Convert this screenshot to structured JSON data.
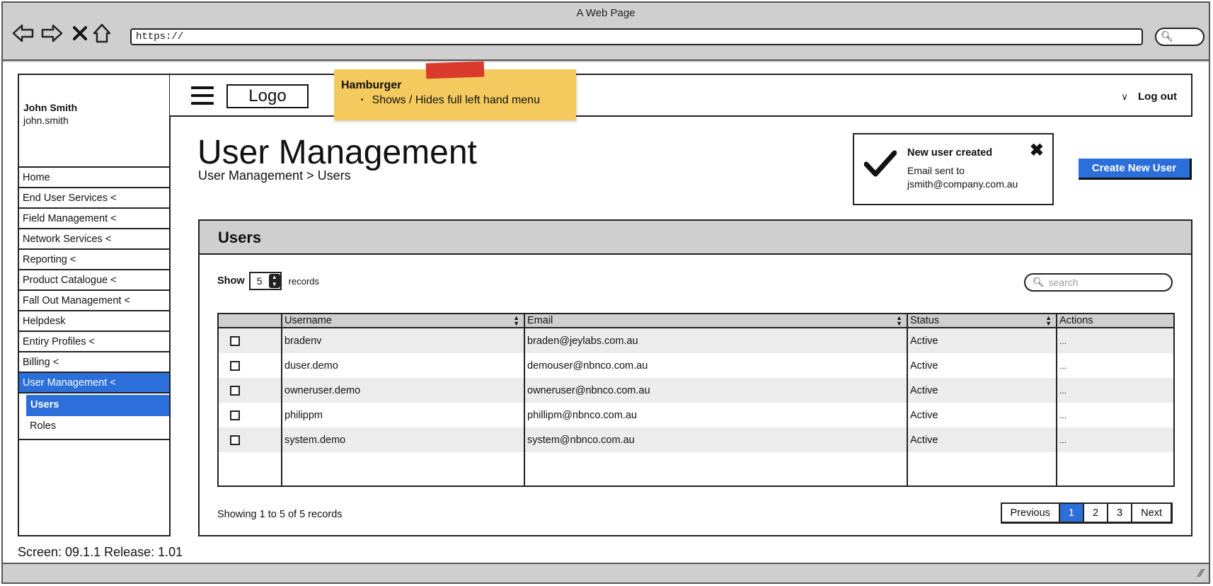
{
  "browser": {
    "title": "A Web Page",
    "url": "https://",
    "back_icon": "arrow-left-icon",
    "forward_icon": "arrow-right-icon",
    "stop_icon": "close-icon",
    "home_icon": "home-icon"
  },
  "user": {
    "name": "John Smith",
    "login": "john.smith"
  },
  "sidebar": {
    "items": [
      {
        "label": "Home"
      },
      {
        "label": "End User Services <"
      },
      {
        "label": "Field Management <"
      },
      {
        "label": "Network Services <"
      },
      {
        "label": "Reporting <"
      },
      {
        "label": "Product Catalogue <"
      },
      {
        "label": "Fall Out Management <"
      },
      {
        "label": "Helpdesk"
      },
      {
        "label": "Entiry Profiles <"
      },
      {
        "label": "Billing <"
      },
      {
        "label": "User Management <"
      }
    ],
    "sub_items": [
      {
        "label": "Users"
      },
      {
        "label": "Roles"
      }
    ]
  },
  "header": {
    "logo": "Logo",
    "logout": "Log out"
  },
  "note": {
    "title": "Hamburger",
    "body": "Shows / Hides full left hand menu"
  },
  "page": {
    "title": "User Management",
    "breadcrumb": "User Management > Users",
    "create_button": "Create New User"
  },
  "toast": {
    "title": "New user created",
    "body": "Email sent to jsmith@company.com.au"
  },
  "panel": {
    "title": "Users",
    "show_label": "Show",
    "page_size": "5",
    "records_label": "records",
    "search_placeholder": "search",
    "columns": [
      "",
      "Username",
      "Email",
      "Status",
      "Actions"
    ],
    "rows": [
      {
        "username": "bradenv",
        "email": "braden@jeylabs.com.au",
        "status": "Active",
        "actions": "..."
      },
      {
        "username": "duser.demo",
        "email": "demouser@nbnco.com.au",
        "status": "Active",
        "actions": "..."
      },
      {
        "username": "owneruser.demo",
        "email": "owneruser@nbnco.com.au",
        "status": "Active",
        "actions": "..."
      },
      {
        "username": "philippm",
        "email": "phillipm@nbnco.com.au",
        "status": "Active",
        "actions": "..."
      },
      {
        "username": "system.demo",
        "email": "system@nbnco.com.au",
        "status": "Active",
        "actions": "..."
      }
    ],
    "summary": "Showing 1 to 5 of 5 records",
    "pager": {
      "previous": "Previous",
      "pages": [
        "1",
        "2",
        "3"
      ],
      "active_page": "1",
      "next": "Next"
    }
  },
  "footer": {
    "screen_info": "Screen: 09.1.1  Release: 1.01"
  },
  "colors": {
    "accent": "#2c6fdb",
    "note": "#f4c95d",
    "tape": "#d93a2b",
    "chrome": "#cfcfcf"
  }
}
